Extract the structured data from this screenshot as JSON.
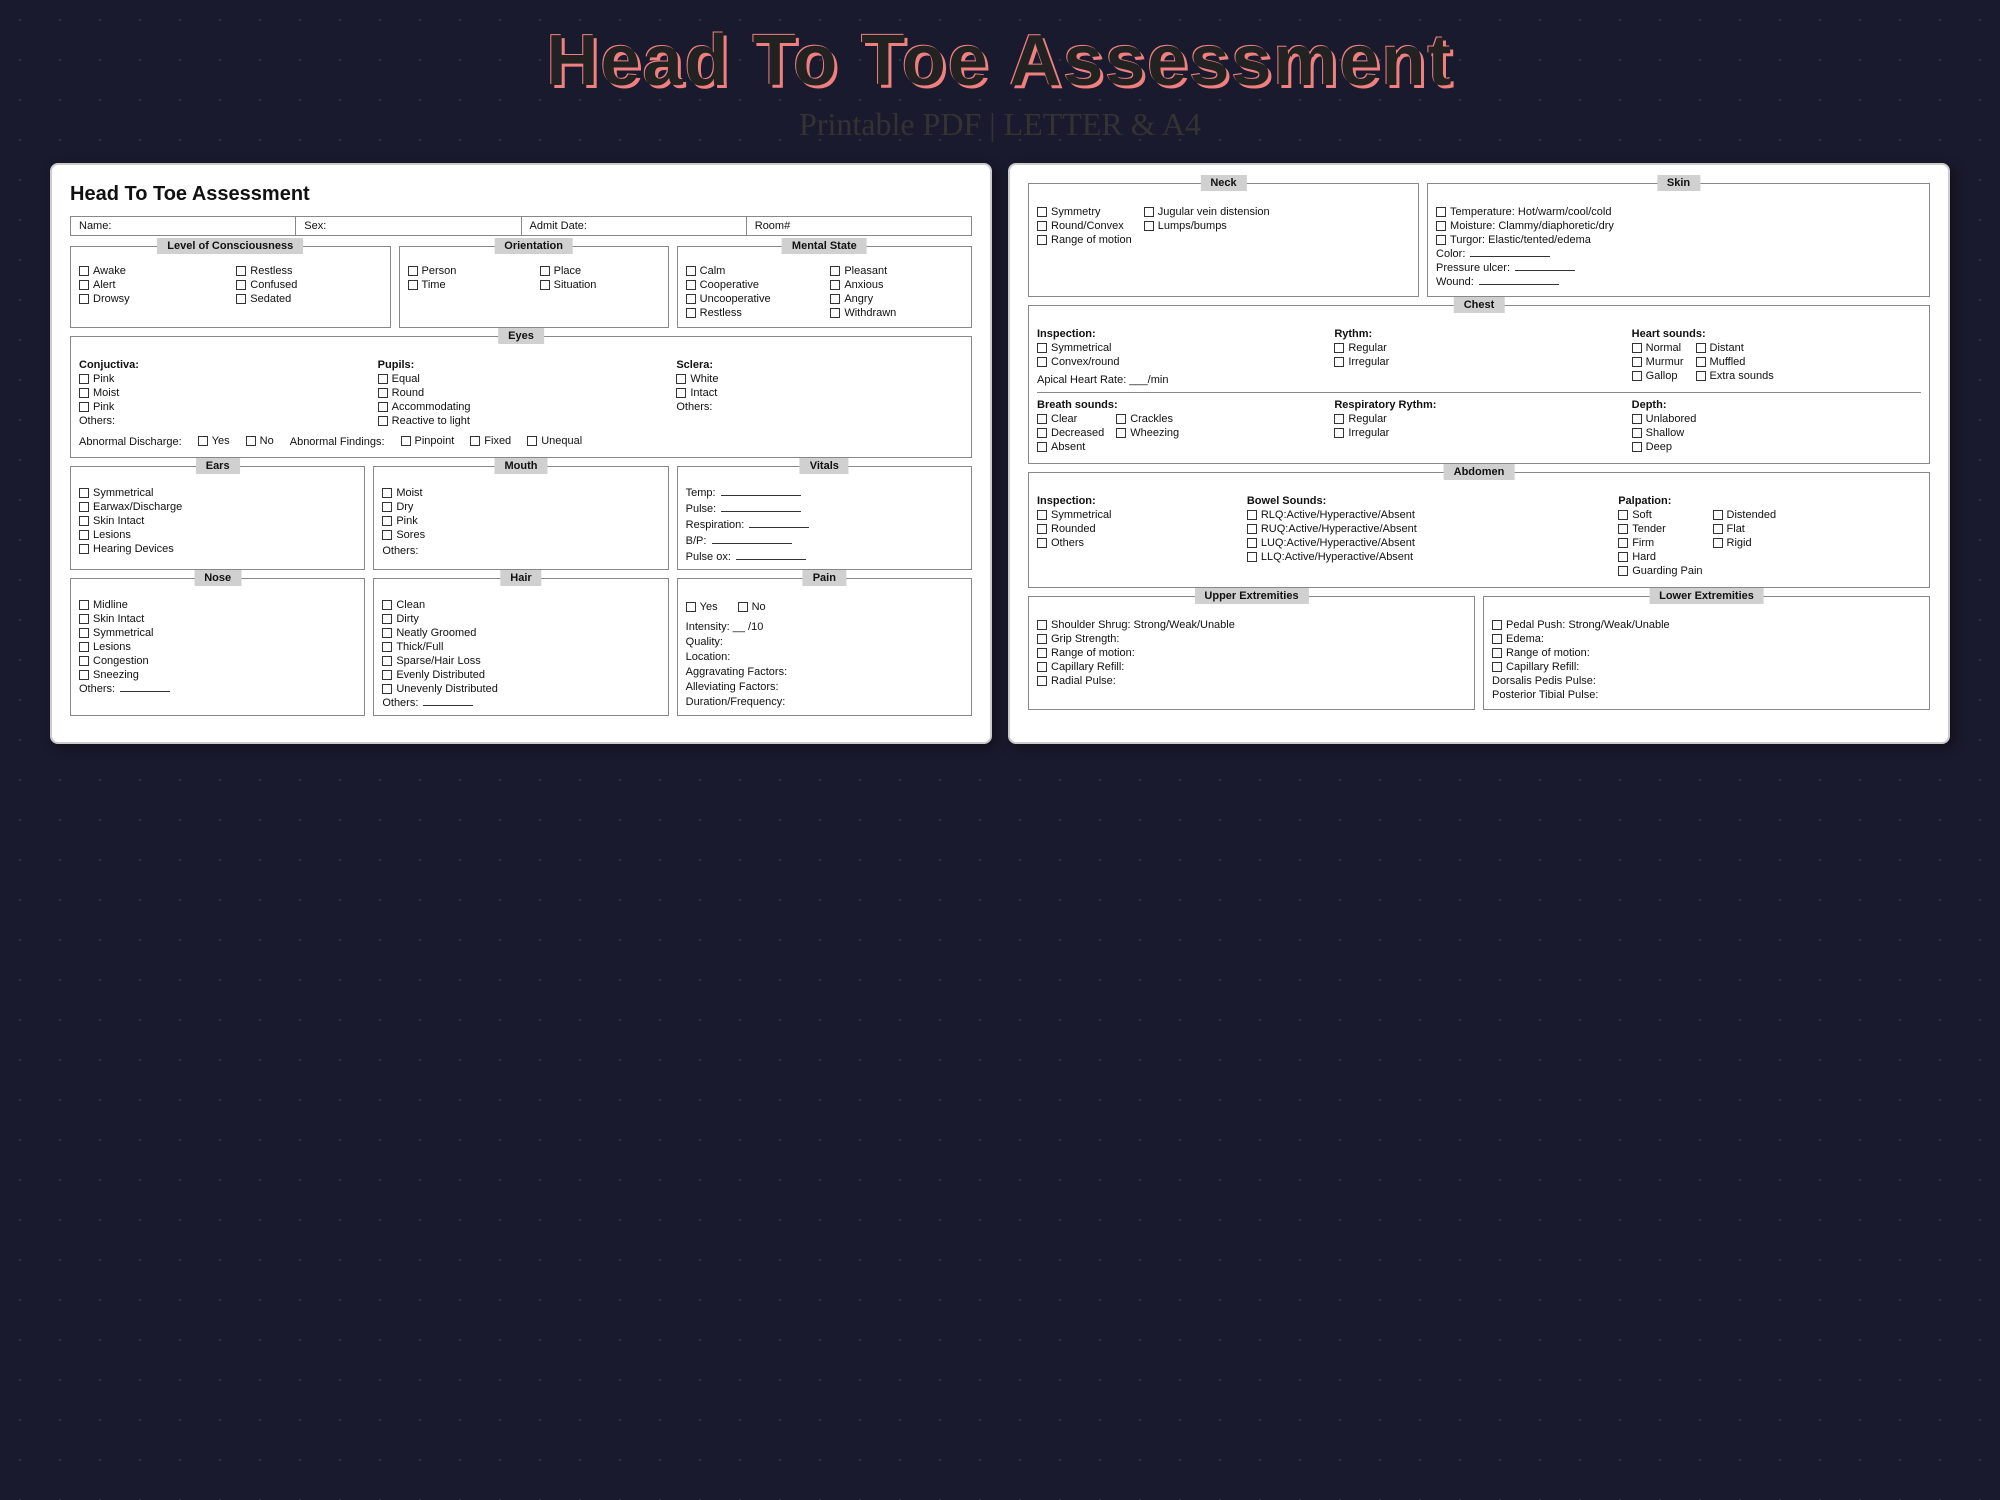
{
  "header": {
    "main_title": "Head To Toe Assessment",
    "sub_title": "Printable PDF | LETTER & A4"
  },
  "left_page": {
    "title": "Head To Toe Assessment",
    "patient_fields": [
      "Name:",
      "Sex:",
      "Admit Date:",
      "Room#"
    ],
    "loc": {
      "label": "Level of Consciousness",
      "col1": [
        "Awake",
        "Alert",
        "Drowsy"
      ],
      "col2": [
        "Restless",
        "Confused",
        "Sedated"
      ]
    },
    "orientation": {
      "label": "Orientation",
      "col1": [
        "Person",
        "Time"
      ],
      "col2": [
        "Place",
        "Situation"
      ]
    },
    "mental": {
      "label": "Mental State",
      "col1": [
        "Calm",
        "Cooperative",
        "Uncooperative",
        "Restless"
      ],
      "col2": [
        "Pleasant",
        "Anxious",
        "Angry",
        "Withdrawn"
      ]
    },
    "eyes": {
      "label": "Eyes",
      "conjunctiva": {
        "header": "Conjuctiva:",
        "items": [
          "Pink",
          "Moist",
          "Pink"
        ]
      },
      "pupils": {
        "header": "Pupils:",
        "items": [
          "Equal",
          "Round",
          "Accommodating",
          "Reactive to light"
        ]
      },
      "sclera": {
        "header": "Sclera:",
        "items": [
          "White",
          "Intact"
        ],
        "others": "Others:"
      },
      "others_label": "Others:",
      "abnormal_discharge": "Abnormal Discharge:",
      "yes": "Yes",
      "no": "No",
      "abnormal_findings": "Abnormal Findings:",
      "findings": [
        "Pinpoint",
        "Fixed",
        "Unequal"
      ]
    },
    "ears": {
      "label": "Ears",
      "items": [
        "Symmetrical",
        "Earwax/Discharge",
        "Skin Intact",
        "Lesions",
        "Hearing Devices"
      ]
    },
    "mouth": {
      "label": "Mouth",
      "items": [
        "Moist",
        "Dry",
        "Pink",
        "Sores"
      ],
      "others": "Others:"
    },
    "vitals": {
      "label": "Vitals",
      "fields": [
        "Temp:",
        "Pulse:",
        "Respiration:",
        "B/P:",
        "Pulse ox:"
      ]
    },
    "nose": {
      "label": "Nose",
      "items": [
        "Midline",
        "Skin Intact",
        "Symmetrical",
        "Lesions",
        "Congestion",
        "Sneezing"
      ],
      "others": "Others:"
    },
    "hair": {
      "label": "Hair",
      "items": [
        "Clean",
        "Dirty",
        "Neatly Groomed",
        "Thick/Full",
        "Sparse/Hair Loss",
        "Evenly Distributed",
        "Unevenly Distributed"
      ],
      "others": "Others:"
    },
    "pain": {
      "label": "Pain",
      "yes": "Yes",
      "no": "No",
      "fields": [
        "Intensity: __ /10",
        "Quality:",
        "Location:",
        "Aggravating Factors:",
        "Alleviating Factors:",
        "Duration/Frequency:"
      ]
    }
  },
  "right_page": {
    "neck": {
      "label": "Neck",
      "col1": [
        "Symmetry",
        "Round/Convex",
        "Range of motion"
      ],
      "col2": [
        "Jugular vein distension",
        "Lumps/bumps"
      ]
    },
    "skin": {
      "label": "Skin",
      "items": [
        "Temperature: Hot/warm/cool/cold",
        "Moisture: Clammy/diaphoretic/dry",
        "Turgor: Elastic/tented/edema"
      ],
      "line_fields": [
        "Color:",
        "Pressure ulcer:",
        "Wound:"
      ]
    },
    "chest": {
      "label": "Chest",
      "inspection": {
        "header": "Inspection:",
        "items": [
          "Symmetrical",
          "Convex/round"
        ],
        "apical": "Apical Heart Rate: ___/min"
      },
      "rythm": {
        "header": "Rythm:",
        "items": [
          "Regular",
          "Irregular"
        ]
      },
      "heart_sounds": {
        "header": "Heart sounds:",
        "col1": [
          "Normal",
          "Murmur",
          "Gallop"
        ],
        "col2": [
          "Distant",
          "Muffled",
          "Extra sounds"
        ]
      },
      "breath_sounds": {
        "header": "Breath sounds:",
        "col1": [
          "Clear",
          "Decreased",
          "Absent"
        ],
        "col2": [
          "Crackles",
          "Wheezing"
        ]
      },
      "resp_rythm": {
        "header": "Respiratory Rythm:",
        "items": [
          "Regular",
          "Irregular"
        ]
      },
      "depth": {
        "header": "Depth:",
        "items": [
          "Unlabored",
          "Shallow",
          "Deep"
        ]
      }
    },
    "abdomen": {
      "label": "Abdomen",
      "inspection": {
        "header": "Inspection:",
        "items": [
          "Symmetrical",
          "Rounded",
          "Others"
        ]
      },
      "bowel": {
        "header": "Bowel Sounds:",
        "items": [
          "RLQ:Active/Hyperactive/Absent",
          "RUQ:Active/Hyperactive/Absent",
          "LUQ:Active/Hyperactive/Absent",
          "LLQ:Active/Hyperactive/Absent"
        ]
      },
      "palpation": {
        "header": "Palpation:",
        "col1": [
          "Soft",
          "Tender",
          "Firm",
          "Hard",
          "Guarding Pain"
        ],
        "col2": [
          "Distended",
          "Flat",
          "Rigid"
        ]
      }
    },
    "upper_ext": {
      "label": "Upper Extremities",
      "items": [
        "Shoulder Shrug: Strong/Weak/Unable",
        "Grip Strength:",
        "Range of motion:",
        "Capillary Refill:",
        "Radial Pulse:"
      ]
    },
    "lower_ext": {
      "label": "Lower Extremities",
      "items": [
        "Pedal Push: Strong/Weak/Unable",
        "Edema:",
        "Range of motion:",
        "Capillary Refill:",
        "Dorsalis Pedis Pulse:",
        "Posterior Tibial Pulse:"
      ]
    }
  }
}
